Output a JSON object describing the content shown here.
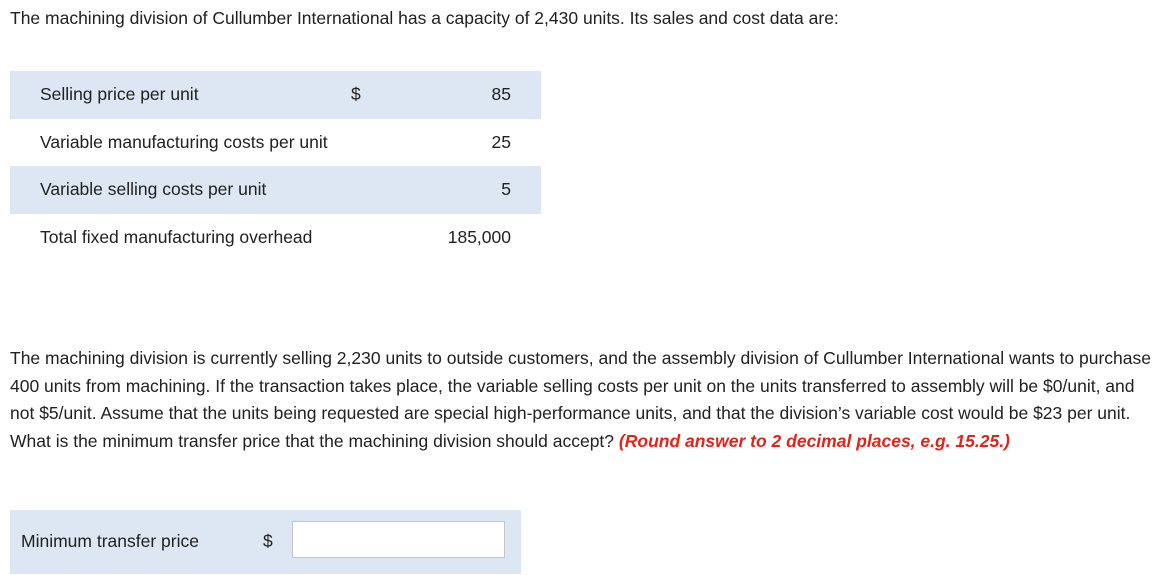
{
  "intro_text": "The machining division of Cullumber International has a capacity of 2,430 units. Its sales and cost data are:",
  "cost_table": {
    "rows": [
      {
        "label": "Selling price per unit",
        "currency": "$",
        "value": "85"
      },
      {
        "label": "Variable manufacturing costs per unit",
        "currency": "",
        "value": "25"
      },
      {
        "label": "Variable selling costs per unit",
        "currency": "",
        "value": "5"
      },
      {
        "label": "Total fixed manufacturing overhead",
        "currency": "",
        "value": "185,000"
      }
    ]
  },
  "question": {
    "text": "The machining division is currently selling 2,230 units to outside customers, and the assembly division of Cullumber International wants to purchase 400 units from machining. If the transaction takes place, the variable selling costs per unit on the units transferred to assembly will be $0/unit, and not $5/unit. Assume that the units being requested are special high-performance units, and that the division’s variable cost would be $23 per unit. What is the minimum transfer price that the machining division should accept?",
    "hint": "(Round answer to 2 decimal places, e.g. 15.25.)"
  },
  "answer": {
    "label": "Minimum transfer price",
    "currency": "$",
    "value": ""
  },
  "colors": {
    "shaded_row": "#dce7f3",
    "hint_red": "#e2231a",
    "text": "#212121"
  }
}
